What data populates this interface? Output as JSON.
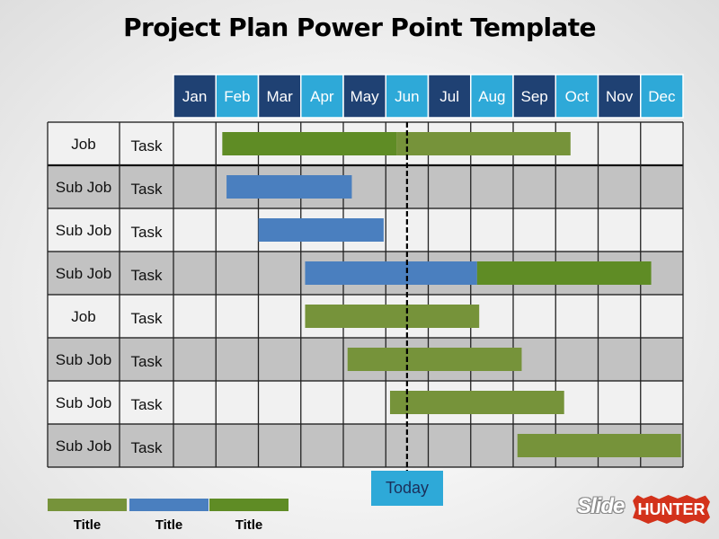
{
  "title": "Project Plan Power Point Template",
  "colors": {
    "month_dark": "#1f4173",
    "month_light": "#2ea9d8",
    "green_dark": "#5f8c25",
    "green_light": "#76933a",
    "blue": "#4a7fbf",
    "row_light": "#f1f1f1",
    "row_dark": "#c2c2c2",
    "today_box": "#2ea9d8"
  },
  "chart_data": {
    "type": "gantt",
    "title": "Project Plan Power Point Template",
    "months": [
      "Jan",
      "Feb",
      "Mar",
      "Apr",
      "May",
      "Jun",
      "Jul",
      "Aug",
      "Sep",
      "Oct",
      "Nov",
      "Dec"
    ],
    "x_unit": "months from start of Jan",
    "xlim": [
      0,
      12
    ],
    "today": 5.5,
    "today_label": "Today",
    "rows": [
      {
        "job": "Job",
        "task": "Task",
        "shade": "light",
        "bars": [
          {
            "start": 1.15,
            "end": 5.25,
            "series": 2
          },
          {
            "start": 5.25,
            "end": 9.35,
            "series": 0
          }
        ]
      },
      {
        "job": "Sub Job",
        "task": "Task",
        "shade": "dark",
        "bars": [
          {
            "start": 1.25,
            "end": 4.2,
            "series": 1
          }
        ]
      },
      {
        "job": "Sub Job",
        "task": "Task",
        "shade": "light",
        "bars": [
          {
            "start": 2.0,
            "end": 4.95,
            "series": 1
          }
        ]
      },
      {
        "job": "Sub Job",
        "task": "Task",
        "shade": "dark",
        "bars": [
          {
            "start": 3.1,
            "end": 7.15,
            "series": 1
          },
          {
            "start": 7.15,
            "end": 11.25,
            "series": 2
          }
        ]
      },
      {
        "job": "Job",
        "task": "Task",
        "shade": "light",
        "bars": [
          {
            "start": 3.1,
            "end": 7.2,
            "series": 0
          }
        ]
      },
      {
        "job": "Sub Job",
        "task": "Task",
        "shade": "dark",
        "bars": [
          {
            "start": 4.1,
            "end": 8.2,
            "series": 0
          }
        ]
      },
      {
        "job": "Sub Job",
        "task": "Task",
        "shade": "light",
        "bars": [
          {
            "start": 5.1,
            "end": 9.2,
            "series": 0
          }
        ]
      },
      {
        "job": "Sub Job",
        "task": "Task",
        "shade": "dark",
        "bars": [
          {
            "start": 8.1,
            "end": 11.95,
            "series": 0
          }
        ]
      }
    ],
    "legend": [
      {
        "label": "Title",
        "color": "#76933a"
      },
      {
        "label": "Title",
        "color": "#4a7fbf"
      },
      {
        "label": "Title",
        "color": "#5f8c25"
      }
    ],
    "legend_position": "bottom-left"
  },
  "logo": {
    "part1": "Slide",
    "part2": "HUNTER"
  }
}
